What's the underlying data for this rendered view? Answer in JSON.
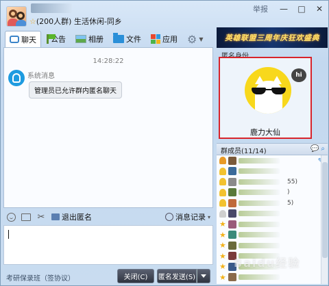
{
  "header": {
    "group_info": "(200人群) 生活休闲-同乡",
    "report_label": "举报",
    "controls": [
      "—",
      "□",
      "✕"
    ]
  },
  "toolbar": {
    "items": [
      {
        "label": "聊天",
        "icon": "chat-icon"
      },
      {
        "label": "公告",
        "icon": "flag-icon"
      },
      {
        "label": "相册",
        "icon": "photo-icon"
      },
      {
        "label": "文件",
        "icon": "folder-icon"
      },
      {
        "label": "应用",
        "icon": "apps-icon"
      }
    ],
    "settings_icon": "gear-icon"
  },
  "chat": {
    "time": "14:28:22",
    "sender": "系统消息",
    "message": "管理员已允许群内匿名聊天"
  },
  "input_bar": {
    "exit_anon_label": "退出匿名",
    "history_label": "消息记录"
  },
  "footer": {
    "left_text": "考研保录班（签协议）",
    "close_label": "关闭(C)",
    "send_label": "匿名发送(S)"
  },
  "banner": {
    "text": "英雄联盟三周年庆狂欢盛典",
    "text_color": "#ffe36b"
  },
  "anon": {
    "title": "匿名身份",
    "badge": "hi",
    "name": "鹿力大仙",
    "highlight_color": "#d8232a"
  },
  "members": {
    "title": "群成员(11/14)",
    "rows": [
      {
        "role": "owner",
        "suffix": ""
      },
      {
        "role": "admin",
        "suffix": ""
      },
      {
        "role": "admin",
        "suffix": "55)"
      },
      {
        "role": "admin",
        "suffix": ")"
      },
      {
        "role": "admin",
        "suffix": "5)"
      },
      {
        "role": "member",
        "suffix": ""
      },
      {
        "role": "star",
        "suffix": ""
      },
      {
        "role": "star",
        "suffix": ""
      },
      {
        "role": "star",
        "suffix": ""
      },
      {
        "role": "star",
        "suffix": ""
      },
      {
        "role": "star",
        "suffix": ""
      },
      {
        "role": "star",
        "suffix": ""
      }
    ]
  },
  "watermark": "Baidu经验"
}
